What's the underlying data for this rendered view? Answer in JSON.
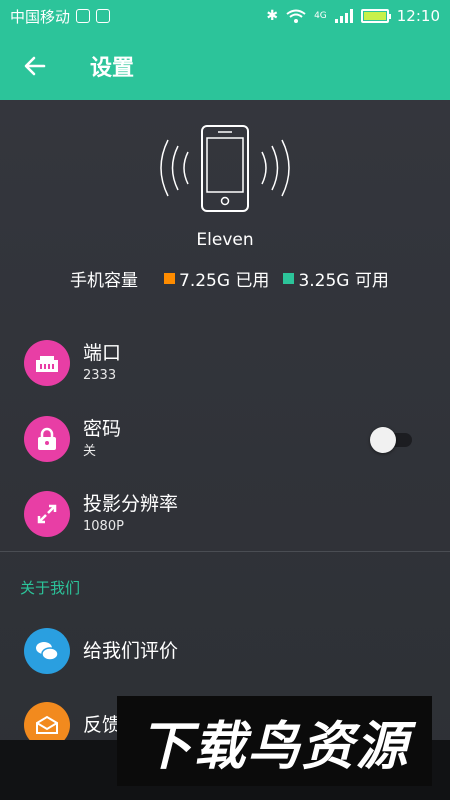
{
  "statusbar": {
    "carrier": "中国移动",
    "network": "4G",
    "time": "12:10"
  },
  "appbar": {
    "title": "设置"
  },
  "device": {
    "name": "Eleven"
  },
  "capacity": {
    "label": "手机容量",
    "used": "7.25G 已用",
    "free": "3.25G 可用",
    "used_color": "#ff8c00",
    "free_color": "#2cc49a"
  },
  "settings": [
    {
      "title": "端口",
      "value": "2333",
      "icon": "ethernet-port-icon",
      "color": "#e83ea5"
    },
    {
      "title": "密码",
      "value": "关",
      "icon": "lock-icon",
      "color": "#e83ea5",
      "toggle_on": false
    },
    {
      "title": "投影分辨率",
      "value": "1080P",
      "icon": "expand-arrows-icon",
      "color": "#e83ea5"
    }
  ],
  "about": {
    "section_title": "关于我们",
    "items": [
      {
        "title": "给我们评价",
        "icon": "chat-bubbles-icon",
        "color": "#2a9fe0"
      },
      {
        "title": "反馈",
        "icon": "mail-icon",
        "color": "#f28a1e"
      }
    ]
  },
  "watermark": {
    "text": "下载鸟资源"
  },
  "colors": {
    "accent": "#2cc49a",
    "background": "#2f3238"
  }
}
